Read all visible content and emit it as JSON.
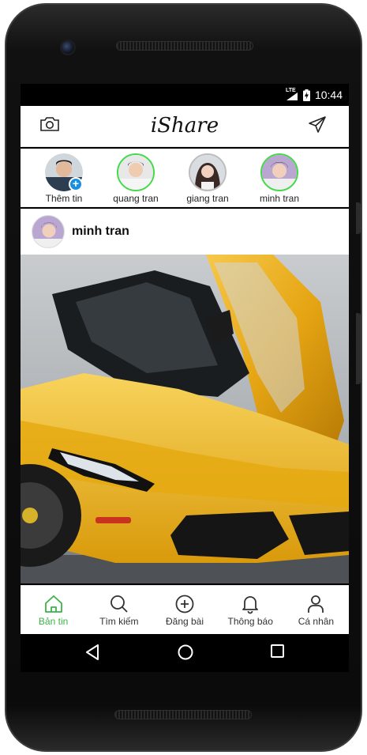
{
  "status_bar": {
    "network": "LTE",
    "time": "10:44"
  },
  "app_bar": {
    "title": "iShare",
    "left_icon": "camera-icon",
    "right_icon": "send-icon"
  },
  "stories": [
    {
      "label": "Thêm tin",
      "ring": "none",
      "badge": "+"
    },
    {
      "label": "quang tran",
      "ring": "green"
    },
    {
      "label": "giang tran",
      "ring": "gray"
    },
    {
      "label": "minh tran",
      "ring": "green"
    }
  ],
  "post": {
    "username": "minh tran",
    "image": "yellow sports car photo"
  },
  "bottom_nav": [
    {
      "label": "Bản tin",
      "icon": "home-icon",
      "active": true
    },
    {
      "label": "Tìm kiếm",
      "icon": "search-icon",
      "active": false
    },
    {
      "label": "Đăng bài",
      "icon": "add-circle-icon",
      "active": false
    },
    {
      "label": "Thông báo",
      "icon": "bell-icon",
      "active": false
    },
    {
      "label": "Cá nhân",
      "icon": "person-icon",
      "active": false
    }
  ],
  "colors": {
    "accent": "#3cb34a",
    "story_ring": "#45d94b",
    "badge": "#1a8fe0"
  }
}
